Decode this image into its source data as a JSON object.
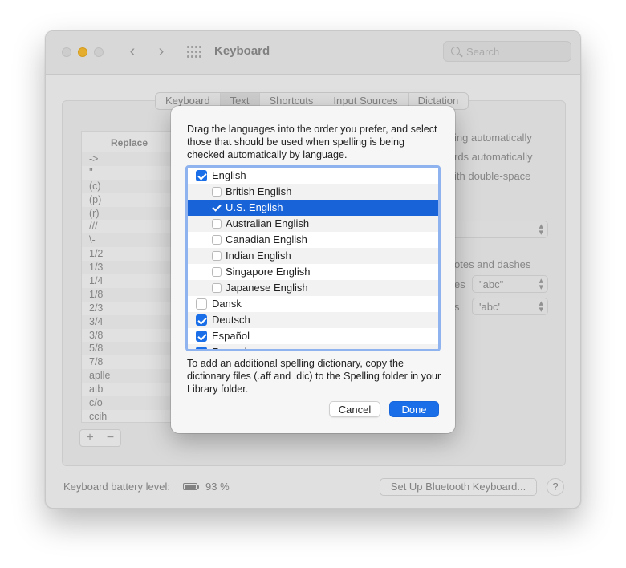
{
  "window": {
    "title": "Keyboard",
    "search_placeholder": "Search"
  },
  "tabs": [
    {
      "label": "Keyboard"
    },
    {
      "label": "Text",
      "active": true
    },
    {
      "label": "Shortcuts"
    },
    {
      "label": "Input Sources"
    },
    {
      "label": "Dictation"
    }
  ],
  "replace_table": {
    "header": "Replace",
    "rows": [
      "->",
      "''",
      "(c)",
      "(p)",
      "(r)",
      "///",
      "\\-",
      "1/2",
      "1/3",
      "1/4",
      "1/8",
      "2/3",
      "3/4",
      "3/8",
      "5/8",
      "7/8",
      "aplle",
      "atb",
      "c/o",
      "ccih"
    ]
  },
  "add_button": "+",
  "remove_button": "−",
  "background_options": {
    "opt1": "ing automatically",
    "opt2": "rds automatically",
    "opt3": "ith double-space",
    "quotes_label": "otes and dashes",
    "double_label": "es",
    "double_value": "\"abc\"",
    "single_label": "s",
    "single_value": "'abc'"
  },
  "footer": {
    "battery_label": "Keyboard battery level:",
    "battery_pct": "93 %",
    "bt_button": "Set Up Bluetooth Keyboard...",
    "help": "?"
  },
  "sheet": {
    "intro": "Drag the languages into the order you prefer, and select those that should be used when spelling is being checked automatically by language.",
    "languages": [
      {
        "label": "English",
        "checked": true,
        "level": 0
      },
      {
        "label": "British English",
        "checked": false,
        "level": 1
      },
      {
        "label": "U.S. English",
        "checked": true,
        "level": 1,
        "selected": true
      },
      {
        "label": "Australian English",
        "checked": false,
        "level": 1
      },
      {
        "label": "Canadian English",
        "checked": false,
        "level": 1
      },
      {
        "label": "Indian English",
        "checked": false,
        "level": 1
      },
      {
        "label": "Singapore English",
        "checked": false,
        "level": 1
      },
      {
        "label": "Japanese English",
        "checked": false,
        "level": 1
      },
      {
        "label": "Dansk",
        "checked": false,
        "level": 0
      },
      {
        "label": "Deutsch",
        "checked": true,
        "level": 0
      },
      {
        "label": "Español",
        "checked": true,
        "level": 0
      },
      {
        "label": "Français",
        "checked": true,
        "level": 0
      }
    ],
    "note": "To add an additional spelling dictionary, copy the dictionary files (.aff and .dic) to the Spelling folder in your Library folder.",
    "cancel_label": "Cancel",
    "done_label": "Done"
  },
  "colors": {
    "accent": "#1a6ee8",
    "selection": "#1963d8",
    "traffic_minimize": "#f2b731"
  }
}
